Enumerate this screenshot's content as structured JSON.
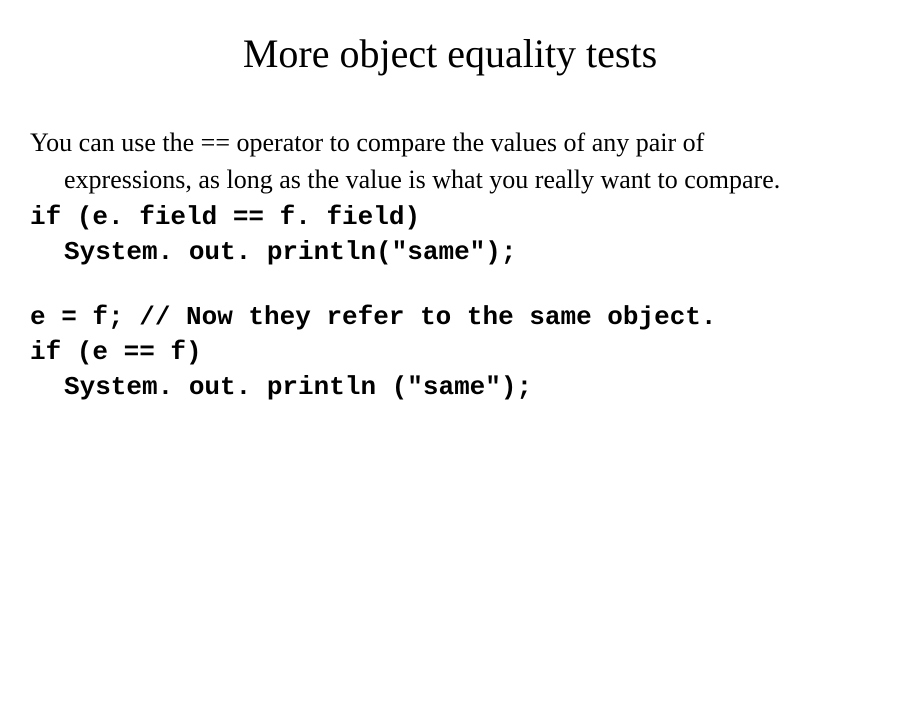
{
  "title": "More object equality tests",
  "para": {
    "line1": "You can use the == operator to compare the values of any pair of",
    "line2": "expressions, as long as the value is what you really want to compare."
  },
  "code1": {
    "l1": "if (e. field == f. field)",
    "l2": "System. out. println(\"same\");"
  },
  "code2": {
    "l1": "e = f; // Now they refer to the same object.",
    "l2": "if (e == f)",
    "l3": "System. out. println (\"same\");"
  }
}
